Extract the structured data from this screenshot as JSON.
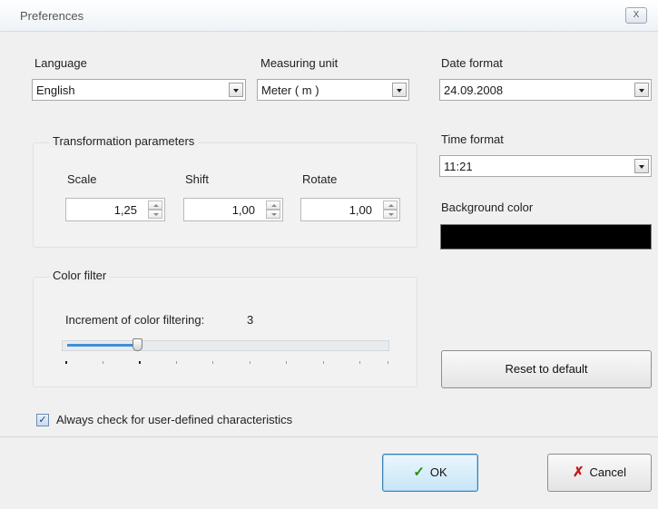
{
  "window": {
    "title": "Preferences",
    "close_glyph": "X"
  },
  "language": {
    "label": "Language",
    "value": "English"
  },
  "measuring_unit": {
    "label": "Measuring unit",
    "value": "Meter ( m )"
  },
  "date_format": {
    "label": "Date format",
    "value": "24.09.2008"
  },
  "time_format": {
    "label": "Time format",
    "value": "11:21"
  },
  "background_color": {
    "label": "Background color",
    "value": "#000000"
  },
  "transformation": {
    "title": "Transformation parameters",
    "scale": {
      "label": "Scale",
      "value": "1,25"
    },
    "shift": {
      "label": "Shift",
      "value": "1,00"
    },
    "rotate": {
      "label": "Rotate",
      "value": "1,00"
    }
  },
  "color_filter": {
    "title": "Color filter",
    "increment_label": "Increment of color filtering:",
    "increment_value": "3",
    "slider_fraction": 0.22
  },
  "reset_label": "Reset to default",
  "always_check": {
    "label": "Always check for user-defined characteristics",
    "checked": true,
    "check_glyph": "✓"
  },
  "footer": {
    "ok_label": "OK",
    "ok_icon": "✓",
    "cancel_label": "Cancel",
    "cancel_icon": "✗"
  }
}
